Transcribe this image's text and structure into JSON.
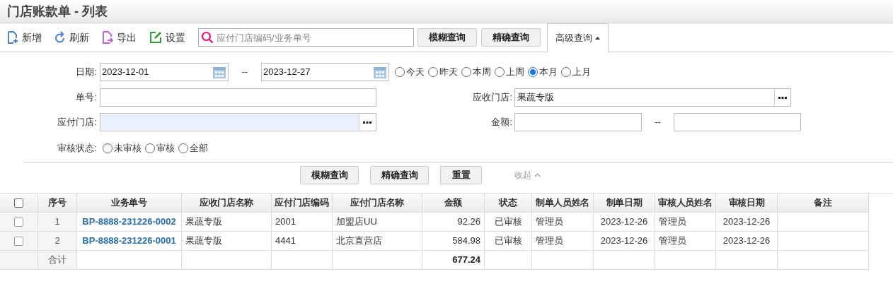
{
  "title": "门店账款单 - 列表",
  "toolbar": {
    "actions": [
      {
        "kind": "add",
        "label": "新增"
      },
      {
        "kind": "refresh",
        "label": "刷新"
      },
      {
        "kind": "export",
        "label": "导出"
      },
      {
        "kind": "settings",
        "label": "设置"
      }
    ],
    "search": {
      "placeholder": "应付门店编码/业务单号"
    },
    "buttons": [
      "模糊查询",
      "精确查询"
    ],
    "advanced": {
      "label": "高级查询",
      "expanded": true
    }
  },
  "filters": {
    "date": {
      "label": "日期:",
      "from": "2023-12-01",
      "separator": "--",
      "to": "2023-12-27",
      "presets": [
        {
          "label": "今天",
          "selected": false
        },
        {
          "label": "昨天",
          "selected": false
        },
        {
          "label": "本周",
          "selected": false
        },
        {
          "label": "上周",
          "selected": false
        },
        {
          "label": "本月",
          "selected": true
        },
        {
          "label": "上月",
          "selected": false
        }
      ]
    },
    "order_no": {
      "label": "单号:"
    },
    "receiving_store": {
      "label": "应收门店:",
      "value": "果蔬专版"
    },
    "paying_store": {
      "label": "应付门店:",
      "focused": true
    },
    "amount": {
      "label": "金额:",
      "separator": "--"
    },
    "audit_status": {
      "label": "审核状态:",
      "options": [
        {
          "label": "未审核",
          "selected": false
        },
        {
          "label": "审核",
          "selected": false
        },
        {
          "label": "全部",
          "selected": false
        }
      ]
    },
    "buttons": [
      "模糊查询",
      "精确查询",
      "重置"
    ],
    "collapse": "收起"
  },
  "table": {
    "select_all_checked": false,
    "columns": [
      "序号",
      "业务单号",
      "应收门店名称",
      "应付门店编码",
      "应付门店名称",
      "金额",
      "状态",
      "制单人员姓名",
      "制单日期",
      "审核人员姓名",
      "审核日期",
      "备注"
    ],
    "rows": [
      {
        "checked": false,
        "cells": [
          "1",
          "BP-8888-231226-0002",
          "果蔬专版",
          "2001",
          "加盟店UU",
          "92.26",
          "已审核",
          "管理员",
          "2023-12-26",
          "管理员",
          "2023-12-26"
        ]
      },
      {
        "checked": false,
        "cells": [
          "2",
          "BP-8888-231226-0001",
          "果蔬专版",
          "4441",
          "北京直营店",
          "584.98",
          "已审核",
          "管理员",
          "2023-12-26",
          "管理员",
          "2023-12-26"
        ]
      }
    ],
    "total": {
      "label": "合计",
      "amount": "677.24"
    }
  }
}
